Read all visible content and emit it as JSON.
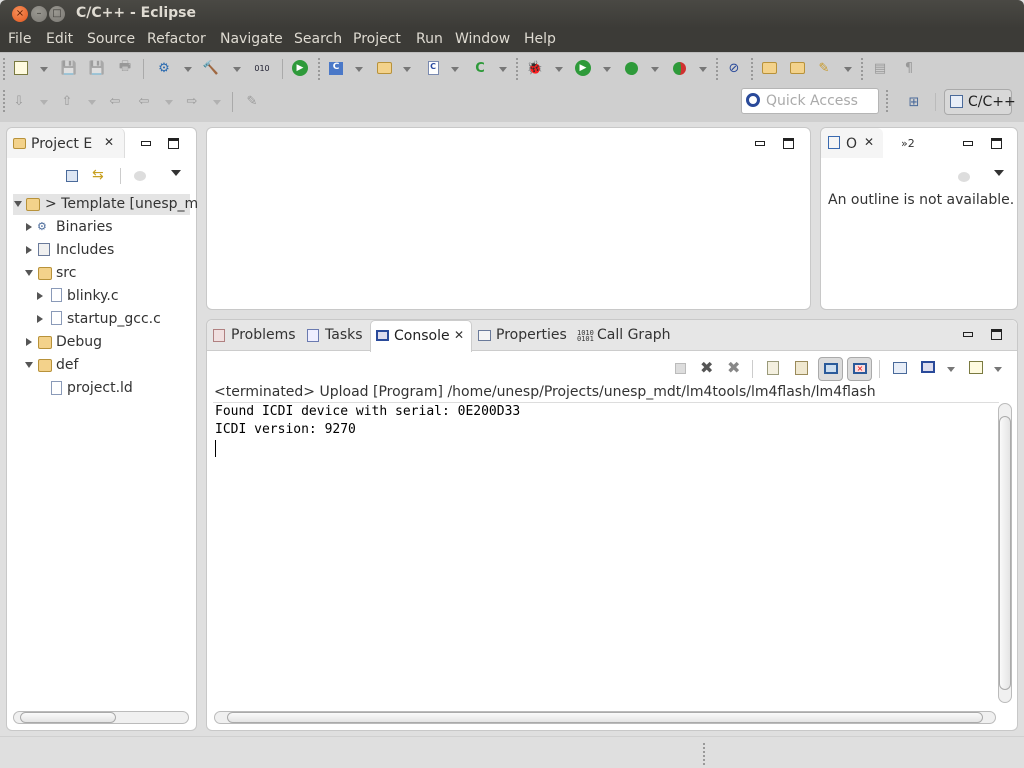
{
  "window": {
    "title": "C/C++ - Eclipse"
  },
  "menu": [
    "File",
    "Edit",
    "Source",
    "Refactor",
    "Navigate",
    "Search",
    "Project",
    "Run",
    "Window",
    "Help"
  ],
  "toolbar": {
    "quick_access_placeholder": "Quick Access",
    "perspective_label": "C/C++"
  },
  "project_explorer": {
    "tab_label": "Project E",
    "tree": [
      {
        "label": "> Template  [unesp_m",
        "level": 0,
        "expanded": true,
        "icon": "project-icon"
      },
      {
        "label": "Binaries",
        "level": 1,
        "expanded": false,
        "icon": "binaries-icon"
      },
      {
        "label": "Includes",
        "level": 1,
        "expanded": false,
        "icon": "includes-icon"
      },
      {
        "label": "src",
        "level": 1,
        "expanded": true,
        "icon": "source-folder-icon"
      },
      {
        "label": "blinky.c",
        "level": 2,
        "expanded": false,
        "icon": "c-file-icon"
      },
      {
        "label": "startup_gcc.c",
        "level": 2,
        "expanded": false,
        "icon": "c-file-icon"
      },
      {
        "label": "Debug",
        "level": 1,
        "expanded": false,
        "icon": "folder-icon"
      },
      {
        "label": "def",
        "level": 1,
        "expanded": true,
        "icon": "folder-icon"
      },
      {
        "label": "project.ld",
        "level": 2,
        "expanded": null,
        "icon": "file-icon"
      }
    ]
  },
  "outline": {
    "tab_label": "O",
    "overflow_label": "»2",
    "message": "An outline is not available."
  },
  "bottom_panel": {
    "tabs": [
      {
        "label": "Problems",
        "active": false
      },
      {
        "label": "Tasks",
        "active": false
      },
      {
        "label": "Console",
        "active": true
      },
      {
        "label": "Properties",
        "active": false
      },
      {
        "label": "Call Graph",
        "active": false
      }
    ],
    "console_header": "<terminated> Upload [Program] /home/unesp/Projects/unesp_mdt/lm4tools/lm4flash/lm4flash",
    "console_lines": [
      "Found ICDI device with serial: 0E200D33",
      "ICDI version: 9270"
    ]
  }
}
